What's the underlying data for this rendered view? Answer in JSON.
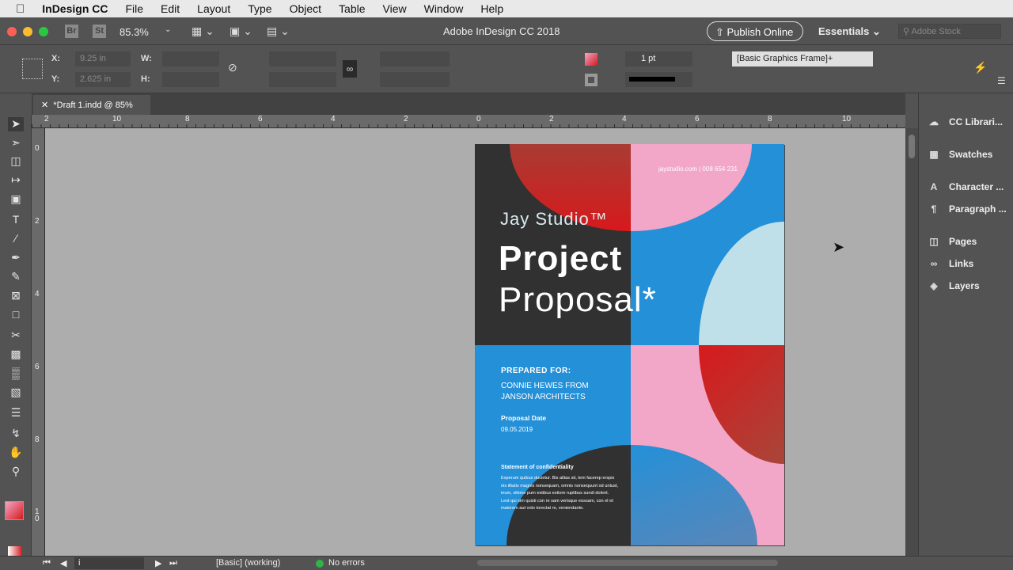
{
  "menubar": {
    "app": "InDesign CC",
    "items": [
      "File",
      "Edit",
      "Layout",
      "Type",
      "Object",
      "Table",
      "View",
      "Window",
      "Help"
    ]
  },
  "titlebar": {
    "zoom": "85.3%",
    "title": "Adobe InDesign CC 2018",
    "publish": "Publish Online",
    "workspace": "Essentials",
    "search_placeholder": "Adobe Stock",
    "br": "Br",
    "st": "St"
  },
  "control": {
    "x_label": "X:",
    "x_value": "9.25 in",
    "y_label": "Y:",
    "y_value": "2.625 in",
    "w_label": "W:",
    "h_label": "H:",
    "stroke_weight": "1 pt",
    "object_style": "[Basic Graphics Frame]+"
  },
  "document": {
    "tab": "*Draft 1.indd @ 85%",
    "ruler_h": [
      "2",
      "10",
      "8",
      "6",
      "4",
      "2",
      "0",
      "2",
      "4",
      "6",
      "8",
      "10"
    ],
    "ruler_v": [
      "0",
      "2",
      "4",
      "6",
      "8",
      "1 0"
    ]
  },
  "page": {
    "contact": "jaystudio.com | 008 654 231",
    "studio": "Jay Studio™",
    "title1": "Project",
    "title2": "Proposal*",
    "prepared_label": "PREPARED FOR:",
    "client": "CONNIE HEWES FROM JANSON ARCHITECTS",
    "date_label": "Proposal Date",
    "date": "09.05.2019",
    "conf_title": "Statement of confidentiality",
    "conf_body": "Experum quibus ducietur. Bis alitas sit, tem facerep erspis nis ilitatis magnis nonsequam, omnis nonsequunt od untust, inum, sitione pum estibus estiore ruptibus sundi dolent. Lest qui sim quisti con re sam verisque eossam, con el et maiorem aut volo torectat re, veniendante."
  },
  "panels": [
    "CC Librari...",
    "Swatches",
    "Character ...",
    "Paragraph ...",
    "Pages",
    "Links",
    "Layers"
  ],
  "status": {
    "page": "i",
    "style": "[Basic] (working)",
    "errors": "No errors"
  },
  "colors": {
    "blue": "#2490d8",
    "pink": "#f2a6c8",
    "dark": "#313132",
    "red": "#d7191c",
    "lightblue": "#bfe0e8"
  }
}
